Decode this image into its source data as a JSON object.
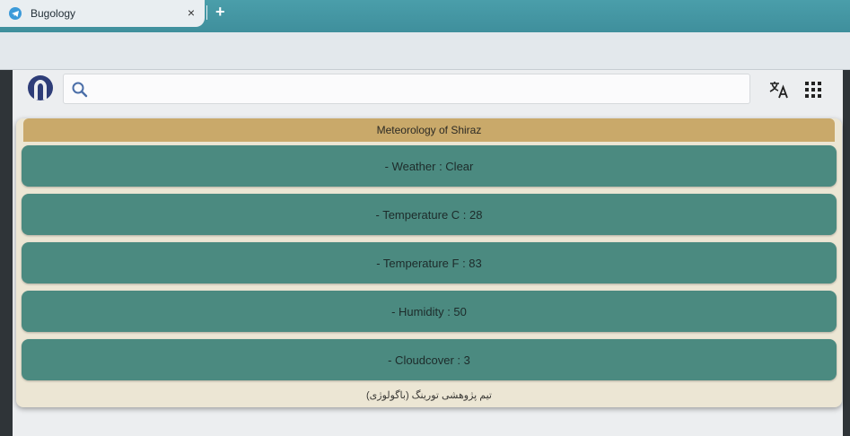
{
  "browser": {
    "tab_title": "Bugology",
    "close_glyph": "×",
    "new_tab_glyph": "+"
  },
  "search": {
    "placeholder": "",
    "value": ""
  },
  "icons": {
    "tab": "telegram-icon",
    "avatar": "account-avatar-icon",
    "search": "search-icon",
    "translate": "translate-icon",
    "apps": "apps-grid-icon"
  },
  "colors": {
    "header": "#c9a96a",
    "row": "#4b8a80",
    "card": "#ece6d4",
    "tab_accent": "#4a9eaa"
  },
  "weather": {
    "title": "Meteorology of Shiraz",
    "rows": [
      "- Weather : Clear",
      "- Temperature C : 28",
      "- Temperature F : 83",
      "- Humidity : 50",
      "- Cloudcover : 3"
    ],
    "footer": "تیم پژوهشی تورینگ (باگولوژی)"
  }
}
